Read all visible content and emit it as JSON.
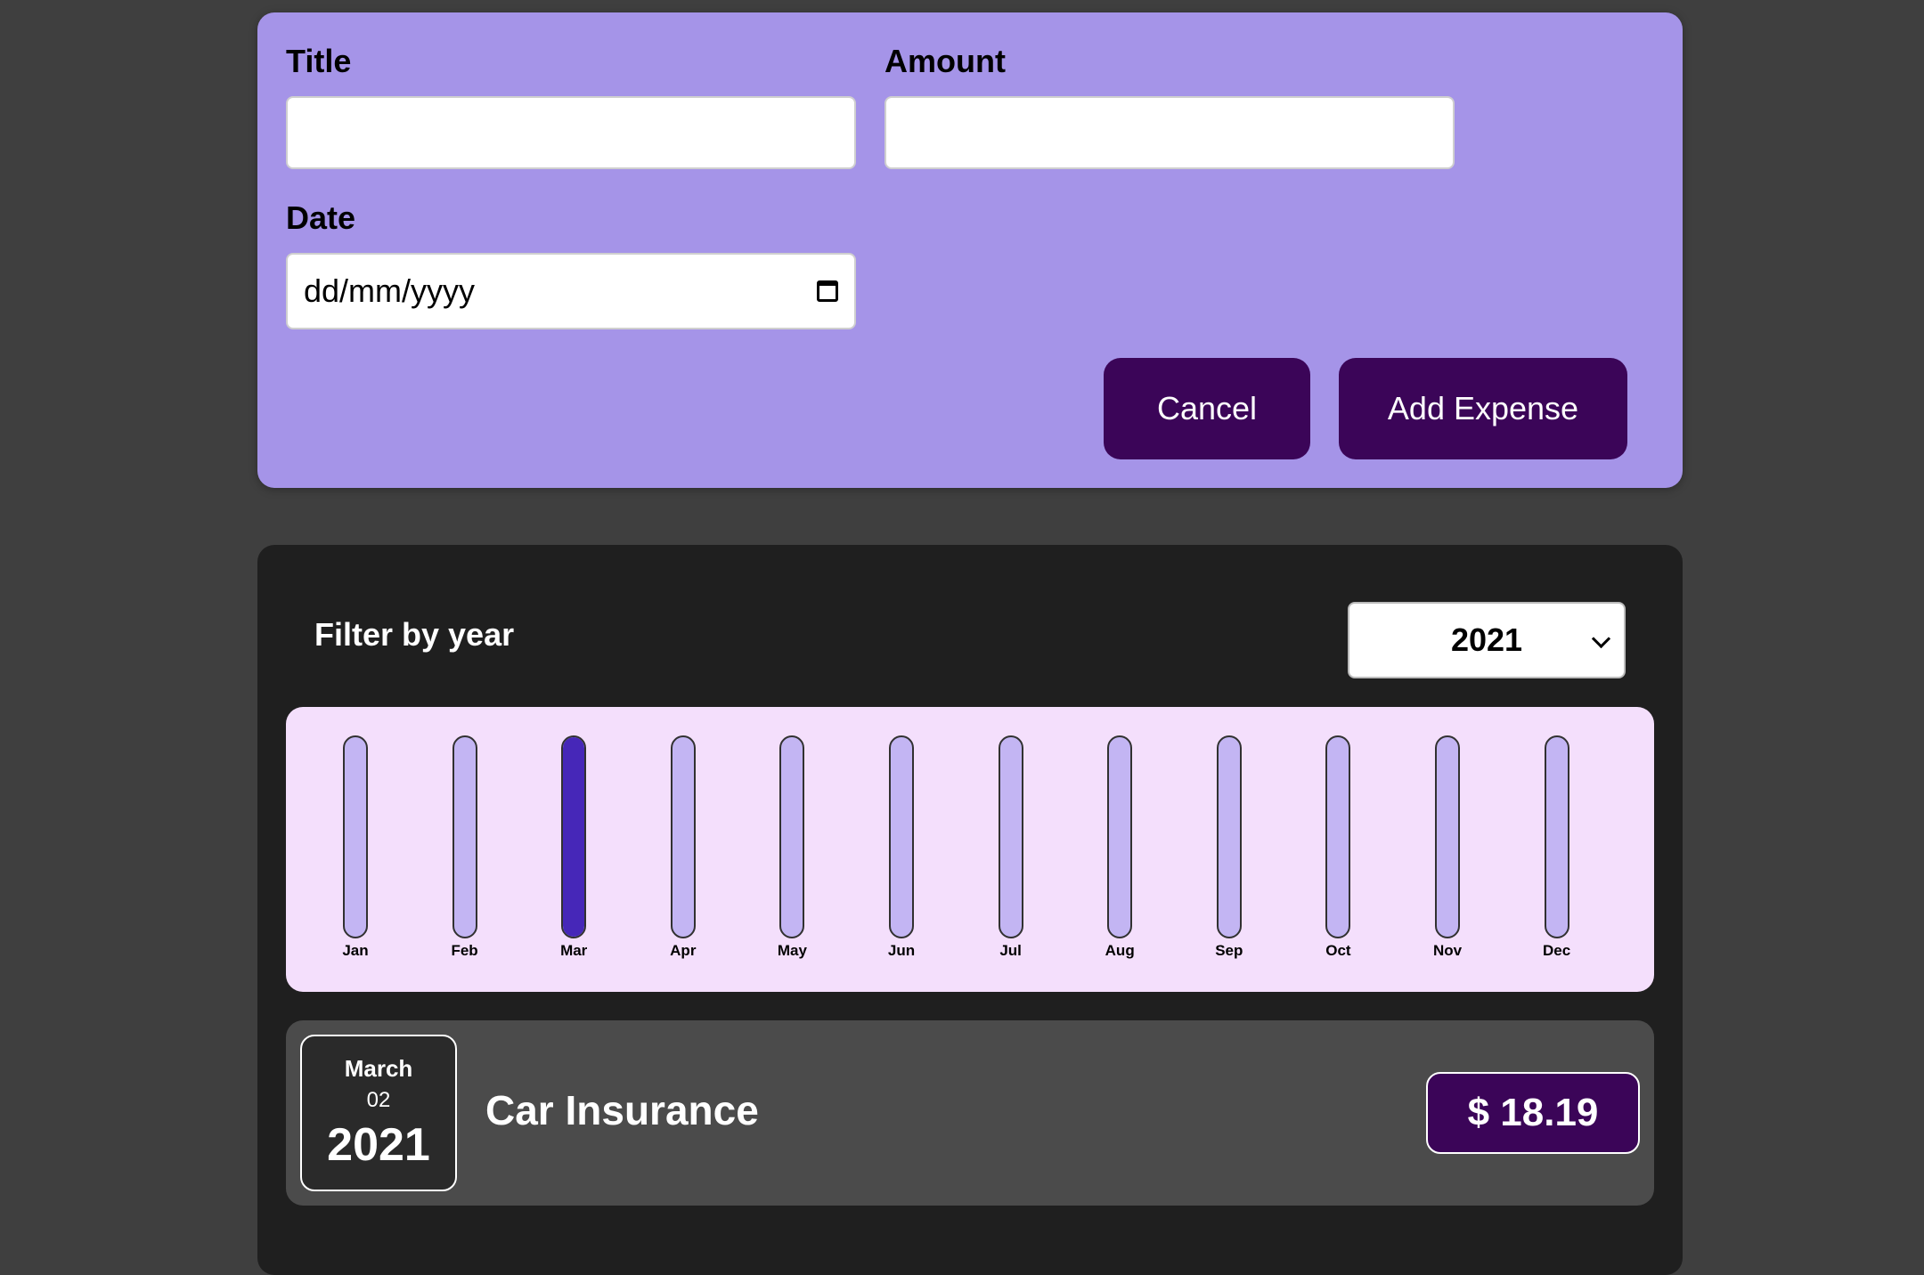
{
  "form": {
    "title_label": "Title",
    "title_value": "",
    "amount_label": "Amount",
    "amount_value": "",
    "date_label": "Date",
    "date_placeholder": "dd/mm/yyyy",
    "cancel_label": "Cancel",
    "submit_label": "Add Expense"
  },
  "filter": {
    "label": "Filter by year",
    "selected_year": "2021"
  },
  "chart_data": {
    "type": "bar",
    "categories": [
      "Jan",
      "Feb",
      "Mar",
      "Apr",
      "May",
      "Jun",
      "Jul",
      "Aug",
      "Sep",
      "Oct",
      "Nov",
      "Dec"
    ],
    "values": [
      0,
      0,
      18.19,
      0,
      0,
      0,
      0,
      0,
      0,
      0,
      0,
      0
    ],
    "max_value": 18.19,
    "colors": {
      "track": "#c3b5f3",
      "fill": "#4627b8",
      "background": "#f4dffc"
    }
  },
  "expenses": [
    {
      "month": "March",
      "day": "02",
      "year": "2021",
      "title": "Car Insurance",
      "amount": "$ 18.19"
    }
  ],
  "colors": {
    "page_background": "#3f3f3f",
    "form_background": "#a594e8",
    "button": "#3b0558",
    "list_background": "#1f1f1f",
    "item_background": "#4b4b4b"
  }
}
